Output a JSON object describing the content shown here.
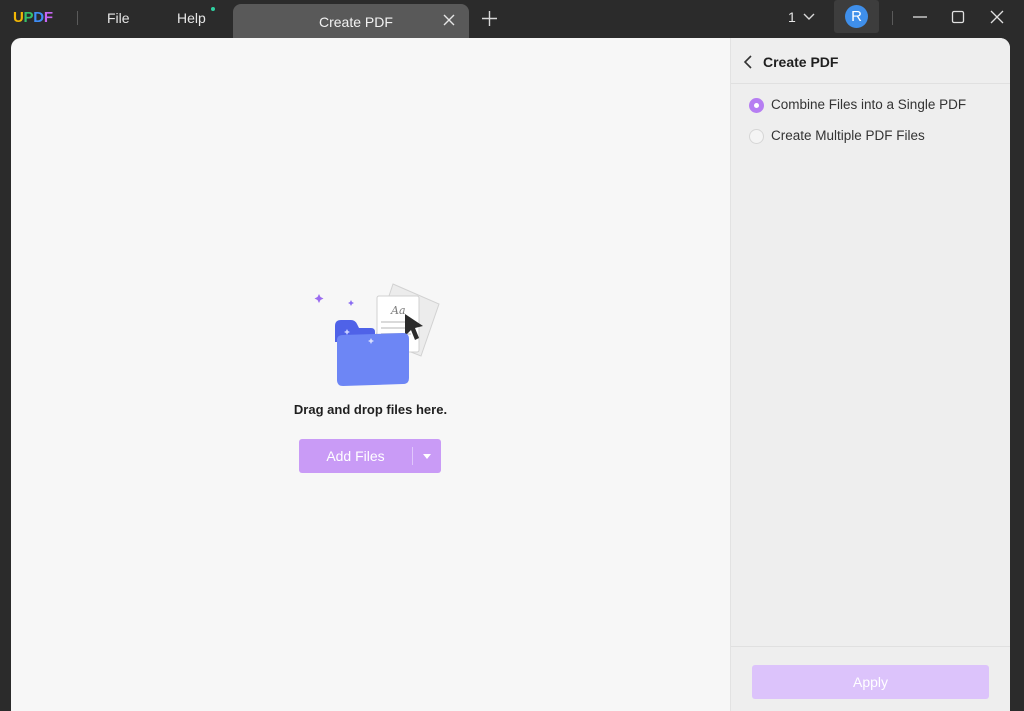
{
  "app": {
    "logo_letters": [
      "U",
      "P",
      "D",
      "F"
    ],
    "logo_colors": [
      "#f2b705",
      "#34c06b",
      "#3e8ef7",
      "#c866f4"
    ]
  },
  "menu": {
    "file": "File",
    "help": "Help"
  },
  "tabs": [
    {
      "label": "Create PDF",
      "active": true
    }
  ],
  "titlebar": {
    "page_count": "1",
    "avatar_letter": "R"
  },
  "dropzone": {
    "instruction": "Drag and drop files here.",
    "add_files_label": "Add Files"
  },
  "panel": {
    "title": "Create PDF",
    "options": [
      {
        "label": "Combine Files into a Single PDF",
        "selected": true
      },
      {
        "label": "Create Multiple PDF Files",
        "selected": false
      }
    ],
    "apply_label": "Apply"
  },
  "colors": {
    "accent": "#b67ef2",
    "button_primary": "#c99bf6",
    "button_disabled": "#dcc3fb",
    "avatar": "#3f8fea",
    "notification_dot": "#2fd0a1"
  }
}
